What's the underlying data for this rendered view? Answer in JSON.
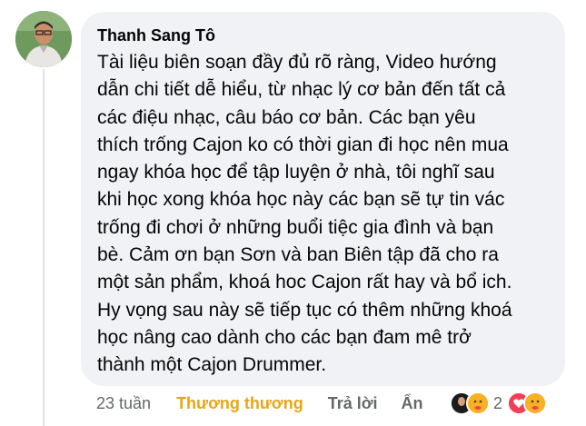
{
  "comment": {
    "author": "Thanh Sang Tô",
    "text_lines": [
      "Tài liệu biên soạn đầy đủ rõ ràng, Video hướng",
      "dẫn chi tiết dễ hiểu, từ nhạc lý cơ bản đến tất cả",
      "các điệu nhạc, câu báo cơ bản. Các bạn yêu",
      "thích trống Cajon ko có thời gian đi học nên mua",
      "ngay khóa học để tập luyện ở nhà, tôi nghĩ sau",
      "khi học xong khóa học này các bạn sẽ tự tin vác",
      "trống đi chơi ở những buổi tiệc gia đình và bạn",
      "bè. Cảm ơn bạn Sơn và ban Biên tập đã cho ra",
      "một sản phẩm, khoá hoc Cajon rất hay và bổ ich.",
      "Hy vọng sau này sẽ tiếp tục có thêm những khoá",
      "học nâng cao dành cho các bạn đam mê trở",
      "thành một Cajon Drummer."
    ]
  },
  "actions": {
    "time": "23 tuần",
    "reaction_label": "Thương thương",
    "reply_label": "Trả lời",
    "hide_label": "Ẩn"
  },
  "reactions": {
    "left_icons": [
      "avatar-icon",
      "care-icon"
    ],
    "count": "2",
    "right_icons": [
      "heart-icon",
      "care-icon"
    ]
  },
  "colors": {
    "bubble": "#f0f2f5",
    "reacted": "#e9a516",
    "muted": "#65676b",
    "heart": "#f33e58"
  }
}
